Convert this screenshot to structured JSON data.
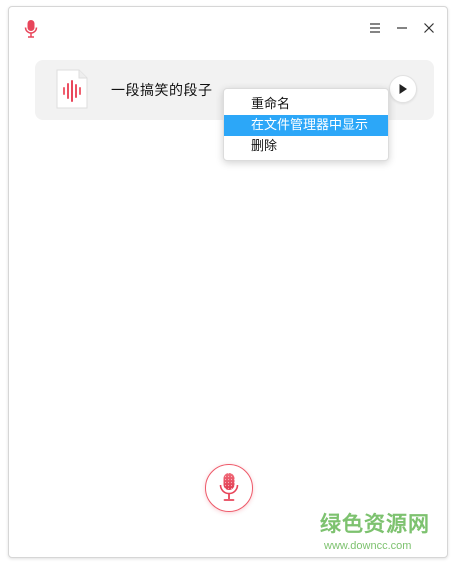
{
  "titlebar": {
    "app_icon": "microphone-icon",
    "buttons": [
      {
        "icon": "hamburger-menu-icon"
      },
      {
        "icon": "minimize-icon"
      },
      {
        "icon": "close-icon"
      }
    ]
  },
  "recording": {
    "title": "一段搞笑的段子",
    "file_icon": "audio-waveform-file-icon",
    "play_icon": "play-icon"
  },
  "context_menu": {
    "items": [
      {
        "label": "重命名",
        "active": false
      },
      {
        "label": "在文件管理器中显示",
        "active": true
      },
      {
        "label": "删除",
        "active": false
      }
    ]
  },
  "record_button": {
    "icon": "microphone-icon"
  },
  "watermark": {
    "name": "绿色资源网",
    "url": "www.downcc.com"
  },
  "colors": {
    "accent": "#2ca7f8",
    "mic_red": "#e8455a",
    "watermark_green": "#7dc26f"
  }
}
